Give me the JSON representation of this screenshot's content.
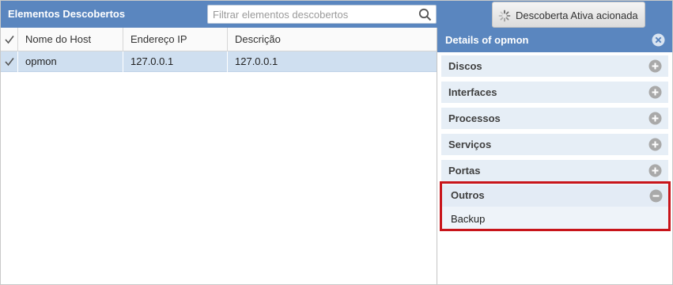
{
  "header": {
    "title": "Elementos Descobertos",
    "search_placeholder": "Filtrar elementos descobertos",
    "discover_button": "Descoberta Ativa acionada"
  },
  "table": {
    "columns": [
      "Nome do Host",
      "Endereço IP",
      "Descrição"
    ],
    "rows": [
      {
        "checked": true,
        "host": "opmon",
        "ip": "127.0.0.1",
        "description": "127.0.0.1"
      }
    ]
  },
  "details": {
    "title": "Details of opmon",
    "sections": [
      {
        "label": "Discos",
        "expanded": false
      },
      {
        "label": "Interfaces",
        "expanded": false
      },
      {
        "label": "Processos",
        "expanded": false
      },
      {
        "label": "Serviços",
        "expanded": false
      },
      {
        "label": "Portas",
        "expanded": false
      },
      {
        "label": "Outros",
        "expanded": true,
        "children": [
          "Backup"
        ]
      }
    ]
  },
  "colors": {
    "header_blue": "#5a86bf",
    "selected_row": "#cfdff0",
    "section_bg": "#e6eef6",
    "highlight_border": "#c8141a"
  },
  "icons": {
    "search": "search-icon",
    "spinner": "spinner-icon",
    "close": "close-icon",
    "expand": "plus-circle-icon",
    "collapse": "minus-circle-icon"
  }
}
